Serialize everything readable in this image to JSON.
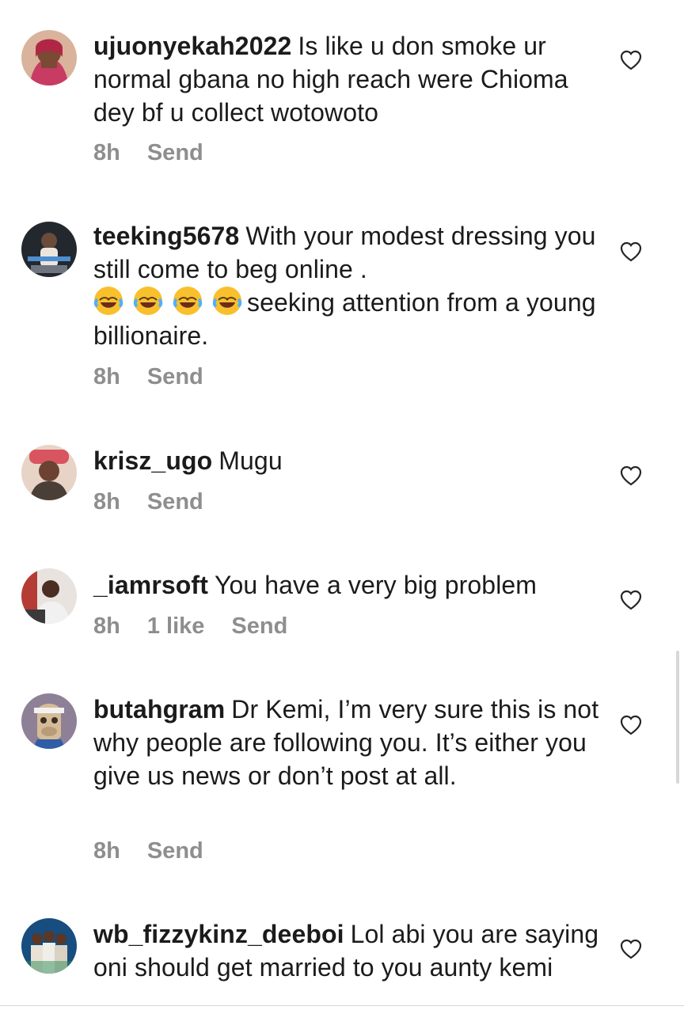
{
  "comments": [
    {
      "user": "ujuonyekah2022",
      "text": "Is like u don smoke ur normal gbana no high reach were Chioma dey bf u collect wotowoto",
      "time": "8h",
      "send": "Send",
      "likes": "",
      "avatar_icon": "woman-avatar"
    },
    {
      "user": "teeking5678",
      "text": "With your modest dressing you still come to beg online .",
      "text2": "seeking attention from a young billionaire.",
      "emojis": [
        "😂",
        "😂",
        "😂",
        "😂"
      ],
      "time": "8h",
      "send": "Send",
      "likes": "",
      "avatar_icon": "man-avatar"
    },
    {
      "user": "krisz_ugo",
      "text": "Mugu",
      "time": "8h",
      "send": "Send",
      "likes": "",
      "avatar_icon": "man-avatar"
    },
    {
      "user": "_iamrsoft",
      "text": "You have a very big problem",
      "time": "8h",
      "likes": "1 like",
      "send": "Send",
      "avatar_icon": "man-avatar"
    },
    {
      "user": "butahgram",
      "text": "Dr Kemi, I’m very sure this is not why people are following you. It’s either you give us news or don’t post at all.",
      "time": "8h",
      "send": "Send",
      "likes": "",
      "avatar_icon": "ape-avatar"
    },
    {
      "user": "wb_fizzykinz_deeboi",
      "text": "Lol abi you are saying oni should get married to you aunty kemi",
      "time": "",
      "send": "",
      "likes": "",
      "avatar_icon": "group-avatar"
    }
  ],
  "colors": {
    "meta": "#8e8e8e",
    "text": "#1b1b1b"
  }
}
